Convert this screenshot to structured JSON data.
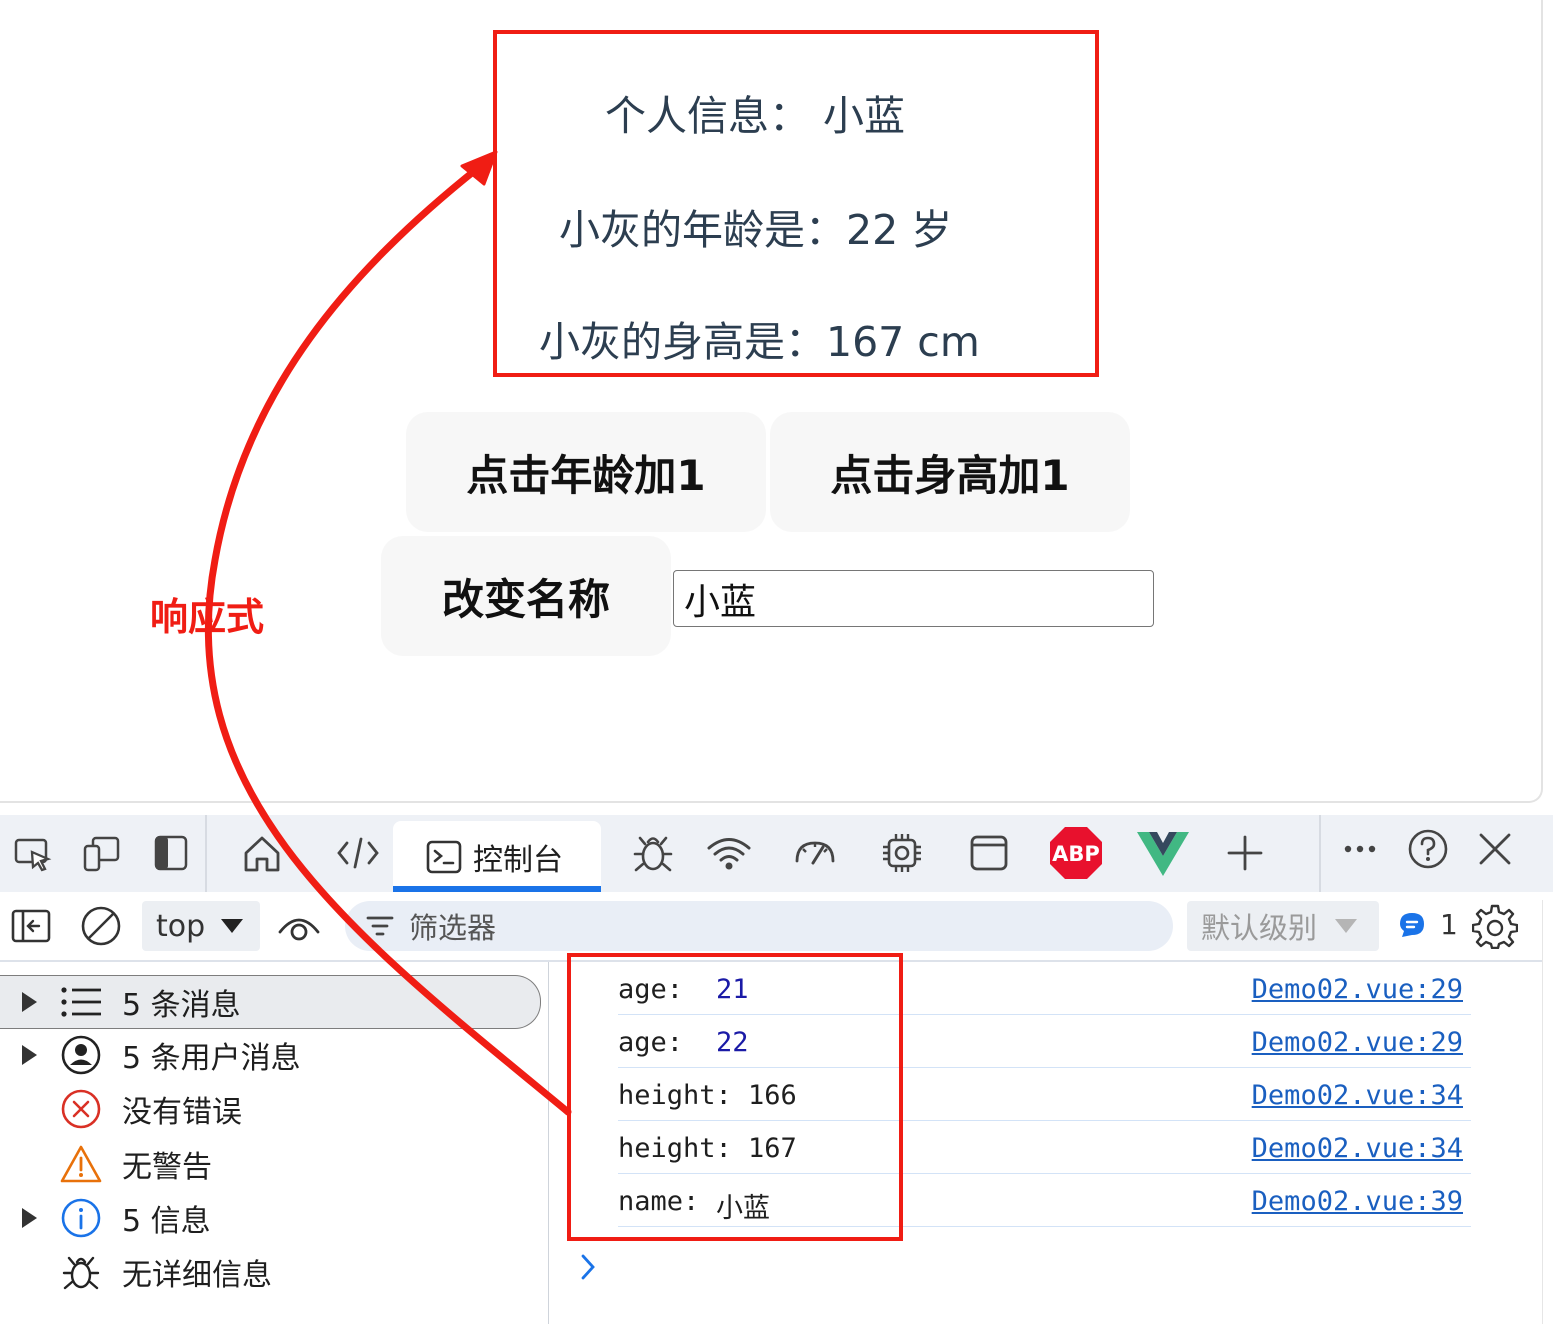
{
  "viewport": {
    "info_line1": "个人信息： 小蓝",
    "info_line2": "小灰的年龄是：22 岁",
    "info_line3": "小灰的身高是：167 cm",
    "btn_age": "点击年龄加1",
    "btn_height": "点击身高加1",
    "btn_name": "改变名称",
    "name_input_value": "小蓝"
  },
  "annotation": {
    "label": "响应式",
    "color": "#f01d14"
  },
  "devtools": {
    "tabs": {
      "console_label": "控制台",
      "icons": [
        "inspect-icon",
        "device-toolbar-icon",
        "dock-icon",
        "home-icon",
        "elements-icon",
        "console-icon",
        "sources-bug-icon",
        "network-wifi-icon",
        "performance-gauge-icon",
        "memory-chip-icon",
        "application-window-icon",
        "adblock-plus-icon",
        "vue-devtools-icon",
        "more-tools-plus-icon",
        "more-menu-icon",
        "help-icon",
        "close-icon"
      ]
    },
    "toolbar": {
      "context": "top",
      "filter_placeholder": "筛选器",
      "level": "默认级别",
      "issue_count": "1"
    },
    "sidebar": [
      {
        "label": "5 条消息",
        "icon": "list-icon"
      },
      {
        "label": "5 条用户消息",
        "icon": "user-icon"
      },
      {
        "label": "没有错误",
        "icon": "error-icon"
      },
      {
        "label": "无警告",
        "icon": "warning-icon"
      },
      {
        "label": "5 信息",
        "icon": "info-icon"
      },
      {
        "label": "无详细信息",
        "icon": "verbose-bug-icon"
      }
    ],
    "logs": [
      {
        "key": "age:",
        "value": "21",
        "source": "Demo02.vue:29"
      },
      {
        "key": "age:",
        "value": "22",
        "source": "Demo02.vue:29"
      },
      {
        "key": "height:",
        "value": "166",
        "source": "Demo02.vue:34"
      },
      {
        "key": "height:",
        "value": "167",
        "source": "Demo02.vue:34"
      },
      {
        "key": "name:",
        "value": "小蓝",
        "source": "Demo02.vue:39"
      }
    ],
    "colors": {
      "number": "#1a1aa6",
      "link": "#1a5fc0",
      "accent": "#1a73e8"
    }
  }
}
